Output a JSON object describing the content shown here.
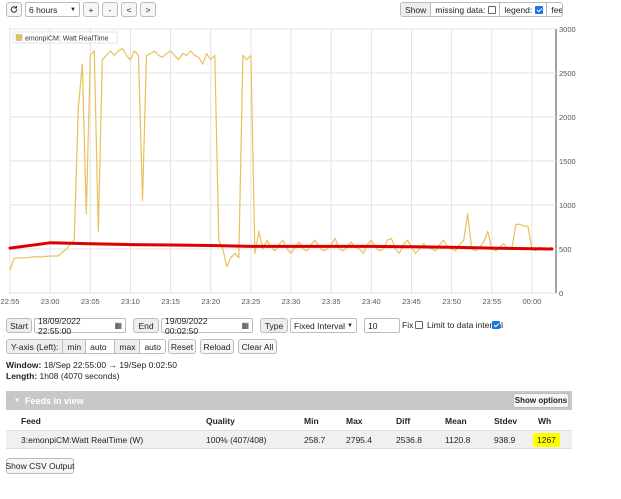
{
  "toolbar": {
    "timeframe_value": "6 hours",
    "zoom_in_label": "+",
    "zoom_out_label": "-",
    "pan_left_label": "<",
    "pan_right_label": ">",
    "show_label": "Show",
    "missing_data_label": "missing data:",
    "missing_data_checked": false,
    "legend_label": "legend:",
    "legend_checked": true,
    "feed_tag_label": "feed tag:",
    "feed_tag_checked": true
  },
  "chart_data": {
    "type": "line",
    "x_tick_labels": [
      "22:55",
      "23:00",
      "23:05",
      "23:10",
      "23:15",
      "23:20",
      "23:25",
      "23:30",
      "23:35",
      "23:40",
      "23:45",
      "23:50",
      "23:55",
      "00:00"
    ],
    "y_ticks": [
      0,
      500,
      1000,
      1500,
      2000,
      2500,
      3000
    ],
    "ylim": [
      0,
      3000
    ],
    "grid": true,
    "legend_position": "top-left",
    "series": [
      {
        "name": "emonpiCM: Watt RealTime",
        "color": "#e8c15a",
        "x_minutes": [
          0,
          0.5,
          1,
          2,
          3,
          4,
          5,
          6,
          6.5,
          7,
          7.5,
          8,
          8.5,
          9,
          9.5,
          10,
          10.5,
          11,
          11.5,
          12,
          12.5,
          13,
          13.5,
          14,
          14.5,
          15,
          15.5,
          16,
          16.5,
          17,
          17.5,
          18,
          18.5,
          19,
          19.5,
          20,
          20.5,
          21,
          21.5,
          22,
          22.5,
          23,
          23.5,
          24,
          24.5,
          25,
          25.5,
          26,
          26.5,
          27,
          27.5,
          28,
          28.5,
          29,
          29.5,
          30,
          30.5,
          31,
          31.5,
          32,
          32.5,
          33,
          33.5,
          34,
          34.5,
          35,
          35.5,
          36,
          36.5,
          37,
          37.5,
          38,
          38.5,
          39,
          39.5,
          40,
          40.5,
          41,
          41.5,
          42,
          42.5,
          43,
          43.5,
          44,
          44.5,
          45,
          45.5,
          46,
          46.5,
          47,
          47.5,
          48,
          48.5,
          49,
          49.5,
          50,
          50.5,
          51,
          51.5,
          52,
          52.5,
          53,
          53.5,
          54,
          54.5,
          55,
          55.5,
          56,
          56.5,
          57,
          57.5,
          58,
          58.5,
          59,
          59.5,
          60,
          60.5,
          61,
          61.5,
          62,
          62.5,
          63,
          63.5,
          64,
          64.5,
          65,
          65.5,
          66,
          66.5,
          67,
          67.5
        ],
        "values": [
          258.7,
          390,
          400,
          400,
          410,
          410,
          420,
          420,
          460,
          500,
          550,
          600,
          2100,
          2600,
          900,
          2700,
          2750,
          700,
          2650,
          2700,
          2750,
          2700,
          2750,
          2780,
          2700,
          2650,
          2750,
          2700,
          1050,
          2700,
          2720,
          2750,
          2700,
          2680,
          2720,
          2750,
          2700,
          2650,
          2720,
          2700,
          2750,
          2700,
          2680,
          2600,
          2720,
          2650,
          2700,
          600,
          500,
          300,
          400,
          450,
          400,
          2700,
          2650,
          2700,
          450,
          700,
          500,
          600,
          520,
          480,
          550,
          600,
          500,
          450,
          520,
          580,
          500,
          480,
          550,
          600,
          520,
          480,
          500,
          550,
          620,
          500,
          480,
          520,
          580,
          520,
          500,
          450,
          550,
          600,
          520,
          480,
          500,
          600,
          620,
          500,
          450,
          550,
          600,
          520,
          450,
          500,
          560,
          520,
          500,
          480,
          550,
          600,
          520,
          500,
          480,
          550,
          600,
          900,
          500,
          480,
          520,
          580,
          700,
          500,
          480,
          520,
          560,
          500,
          500,
          780,
          780,
          760,
          760,
          500,
          480,
          520,
          500,
          500,
          520,
          500,
          500
        ],
        "quality": "100% (407/408)"
      },
      {
        "name": "",
        "color": "#dd0000",
        "x_minutes": [
          0,
          5,
          10,
          15,
          20,
          25,
          30,
          35,
          40,
          45,
          50,
          55,
          60,
          67.5
        ],
        "values": [
          510,
          570,
          560,
          550,
          545,
          540,
          530,
          530,
          530,
          530,
          525,
          520,
          510,
          500
        ]
      }
    ]
  },
  "controls": {
    "start_label": "Start",
    "start_value": "18/09/2022 22:55:00",
    "end_label": "End",
    "end_value": "19/09/2022 00:02:50",
    "type_label": "Type",
    "type_value": "Fixed Interval",
    "interval_value": "10",
    "fix_label": "Fix",
    "fix_checked": false,
    "limit_label": "Limit to data interval",
    "limit_checked": true,
    "yaxis_label": "Y-axis (Left):",
    "min_label": "min",
    "min_value": "auto",
    "max_label": "max",
    "max_value": "auto",
    "reset_label": "Reset",
    "reload_label": "Reload",
    "clear_all_label": "Clear All"
  },
  "info": {
    "window_label": "Window:",
    "window_value": "18/Sep 22:55:00 → 19/Sep 0:02:50",
    "length_label": "Length:",
    "length_value": "1h08 (4070 seconds)"
  },
  "feeds": {
    "title": "Feeds in view",
    "show_options_label": "Show options",
    "columns": [
      "Feed",
      "Quality",
      "Min",
      "Max",
      "Diff",
      "Mean",
      "Stdev",
      "Wh"
    ],
    "rows": [
      {
        "feed": "3:emonpiCM:Watt RealTime (W)",
        "quality": "100% (407/408)",
        "min": "258.7",
        "max": "2795.4",
        "diff": "2536.8",
        "mean": "1120.8",
        "stdev": "938.9",
        "wh": "1267"
      }
    ],
    "wh_highlight_color": "#ffff00"
  },
  "footer": {
    "csv_label": "Show CSV Output"
  }
}
